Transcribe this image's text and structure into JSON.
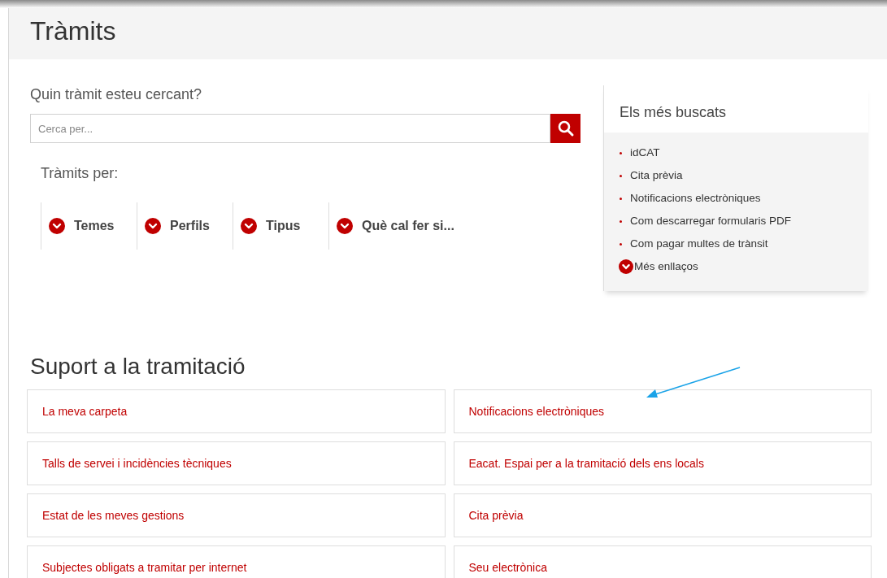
{
  "header": {
    "title": "Tràmits"
  },
  "search": {
    "label": "Quin tràmit esteu cercant?",
    "placeholder": "Cerca per..."
  },
  "filters": {
    "title": "Tràmits per:",
    "items": [
      {
        "label": "Temes",
        "expanded": false
      },
      {
        "label": "Perfils",
        "expanded": false
      },
      {
        "label": "Tipus",
        "expanded": false
      },
      {
        "label": "Què cal fer si...",
        "expanded": false
      }
    ]
  },
  "most_searched": {
    "title": "Els més buscats",
    "links": [
      "idCAT",
      "Cita prèvia",
      "Notificacions electròniques",
      "Com descarregar formularis PDF",
      "Com pagar multes de trànsit"
    ],
    "more": "Més enllaços"
  },
  "support": {
    "title": "Suport a la tramitació",
    "links": [
      "La meva carpeta",
      "Notificacions electròniques",
      "Talls de servei i incidències tècniques",
      "Eacat. Espai per a la tramitació dels ens locals",
      "Estat de les meves gestions",
      "Cita prèvia",
      "Subjectes obligats a tramitar per internet",
      "Seu electrònica"
    ]
  }
}
